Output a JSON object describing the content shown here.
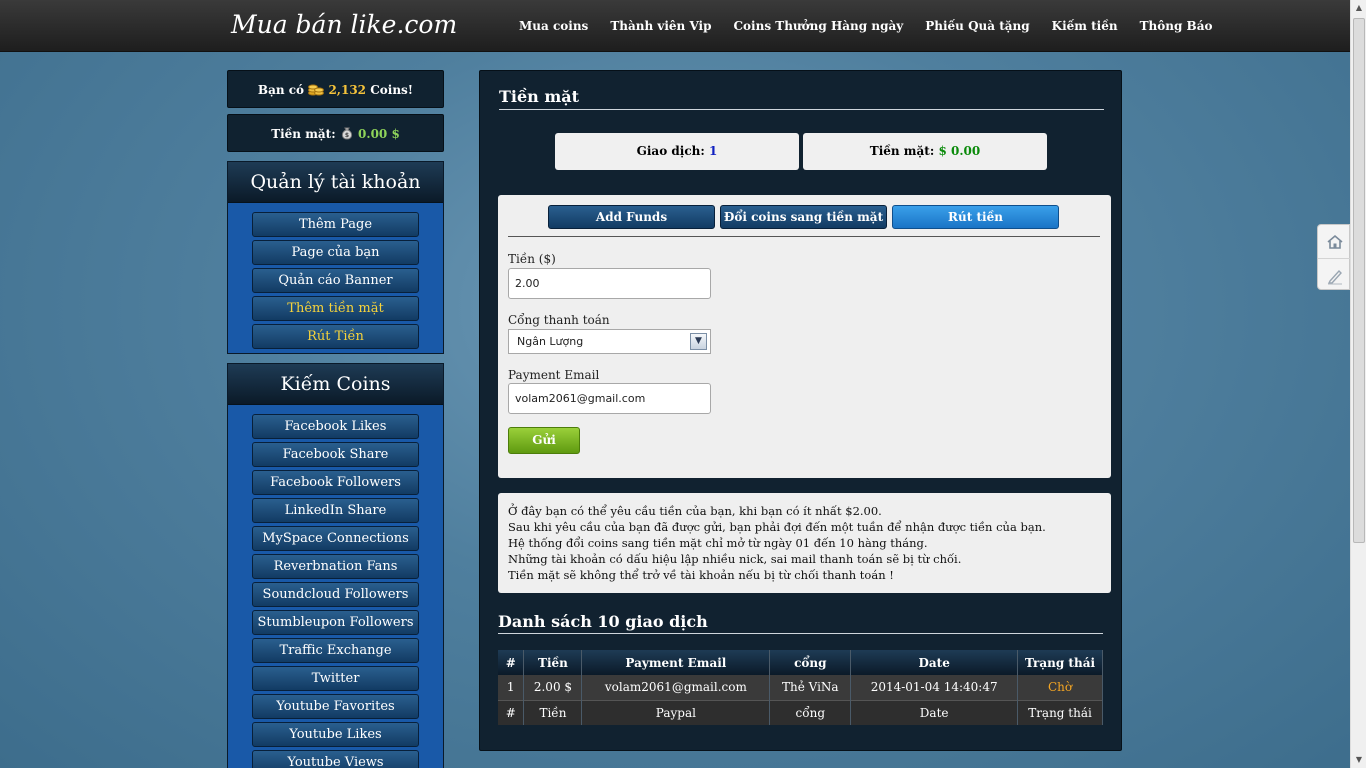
{
  "header": {
    "logo": "Mua bán like.com",
    "nav": [
      "Mua coins",
      "Thành viên Vip",
      "Coins Thưởng Hàng ngày",
      "Phiếu Quà tặng",
      "Kiếm tiền",
      "Thông Báo"
    ]
  },
  "sidebar": {
    "coins_prefix": "Bạn có",
    "coins_value": "2,132",
    "coins_suffix": "Coins!",
    "cash_label": "Tiền mặt:",
    "cash_value": "0.00 $",
    "account_title": "Quản lý tài khoản",
    "account_items": [
      "Thêm Page",
      "Page của bạn",
      "Quản cáo Banner",
      "Thêm tiền mặt",
      "Rút Tiền"
    ],
    "earn_title": "Kiếm Coins",
    "earn_items": [
      "Facebook Likes",
      "Facebook Share",
      "Facebook Followers",
      "LinkedIn Share",
      "MySpace Connections",
      "Reverbnation Fans",
      "Soundcloud Followers",
      "Stumbleupon Followers",
      "Traffic Exchange",
      "Twitter",
      "Youtube Favorites",
      "Youtube Likes",
      "Youtube Views"
    ]
  },
  "main": {
    "title": "Tiền mặt",
    "stat_tx_label": "Giao dịch:",
    "stat_tx_value": "1",
    "stat_cash_label": "Tiền mặt:",
    "stat_cash_value": "$ 0.00",
    "tabs": [
      "Add Funds",
      "Đổi coins sang tiền mặt",
      "Rút tiền"
    ],
    "amount_label": "Tiền ($)",
    "amount_value": "2.00",
    "gateway_label": "Cổng thanh toán",
    "gateway_value": "Ngân Lượng",
    "email_label": "Payment Email",
    "email_value": "volam2061@gmail.com",
    "send_label": "Gửi",
    "info_lines": [
      "Ở đây bạn có thể yêu cầu tiền của bạn, khi bạn có ít nhất $2.00.",
      "Sau khi yêu cầu của bạn đã được gửi, bạn phải đợi đến một tuần để nhận được tiền của bạn.",
      "Hệ thống đổi coins sang tiền mặt chỉ mở từ ngày 01 đến 10 hàng tháng.",
      "Những tài khoản có dấu hiệu lập nhiều nick, sai mail thanh toán sẽ bị từ chối.",
      "Tiền mặt sẽ không thể trở về tài khoản nếu bị từ chối thanh toán !"
    ],
    "list_title": "Danh sách 10 giao dịch",
    "table_headers": [
      "#",
      "Tiền",
      "Payment Email",
      "cổng",
      "Date",
      "Trạng thái"
    ],
    "table_rows": [
      [
        "1",
        "2.00 $",
        "volam2061@gmail.com",
        "Thẻ ViNa",
        "2014-01-04 14:40:47",
        "Chờ"
      ]
    ],
    "table_footer": [
      "#",
      "Tiền",
      "Paypal",
      "cổng",
      "Date",
      "Trạng thái"
    ]
  },
  "colors": {
    "accent_green": "#8fd45a",
    "coin_yellow": "#f5c33b",
    "status_pending": "#f5a623"
  },
  "icons": [
    "coin-stack-icon",
    "money-bag-icon",
    "home-icon",
    "edit-icon"
  ]
}
